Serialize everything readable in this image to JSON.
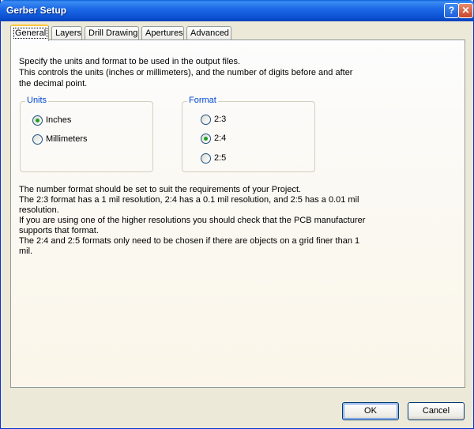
{
  "window": {
    "title": "Gerber Setup",
    "help_label": "?",
    "close_label": "✕"
  },
  "tabs": [
    {
      "label": "General",
      "active": true
    },
    {
      "label": "Layers",
      "active": false
    },
    {
      "label": "Drill Drawing",
      "active": false
    },
    {
      "label": "Apertures",
      "active": false
    },
    {
      "label": "Advanced",
      "active": false
    }
  ],
  "general": {
    "intro_line1": "Specify the units and format to be used in the output files.",
    "intro_line2": "This controls the units (inches or millimeters), and the number of digits before and after the decimal point.",
    "units": {
      "title": "Units",
      "options": [
        {
          "label": "Inches",
          "selected": true
        },
        {
          "label": "Millimeters",
          "selected": false
        }
      ]
    },
    "format": {
      "title": "Format",
      "options": [
        {
          "label": "2:3",
          "selected": false
        },
        {
          "label": "2:4",
          "selected": true
        },
        {
          "label": "2:5",
          "selected": false
        }
      ]
    },
    "notes": [
      "The number format should be set to suit the requirements of your Project.",
      "The 2:3 format has a 1 mil resolution, 2:4 has a 0.1 mil resolution, and 2:5 has a 0.01 mil resolution.",
      "If you are using one of the higher resolutions you should check that the PCB manufacturer supports that format.",
      "The 2:4 and 2:5 formats only need to be chosen if there are objects on a grid finer than 1 mil."
    ]
  },
  "buttons": {
    "ok": "OK",
    "cancel": "Cancel"
  }
}
